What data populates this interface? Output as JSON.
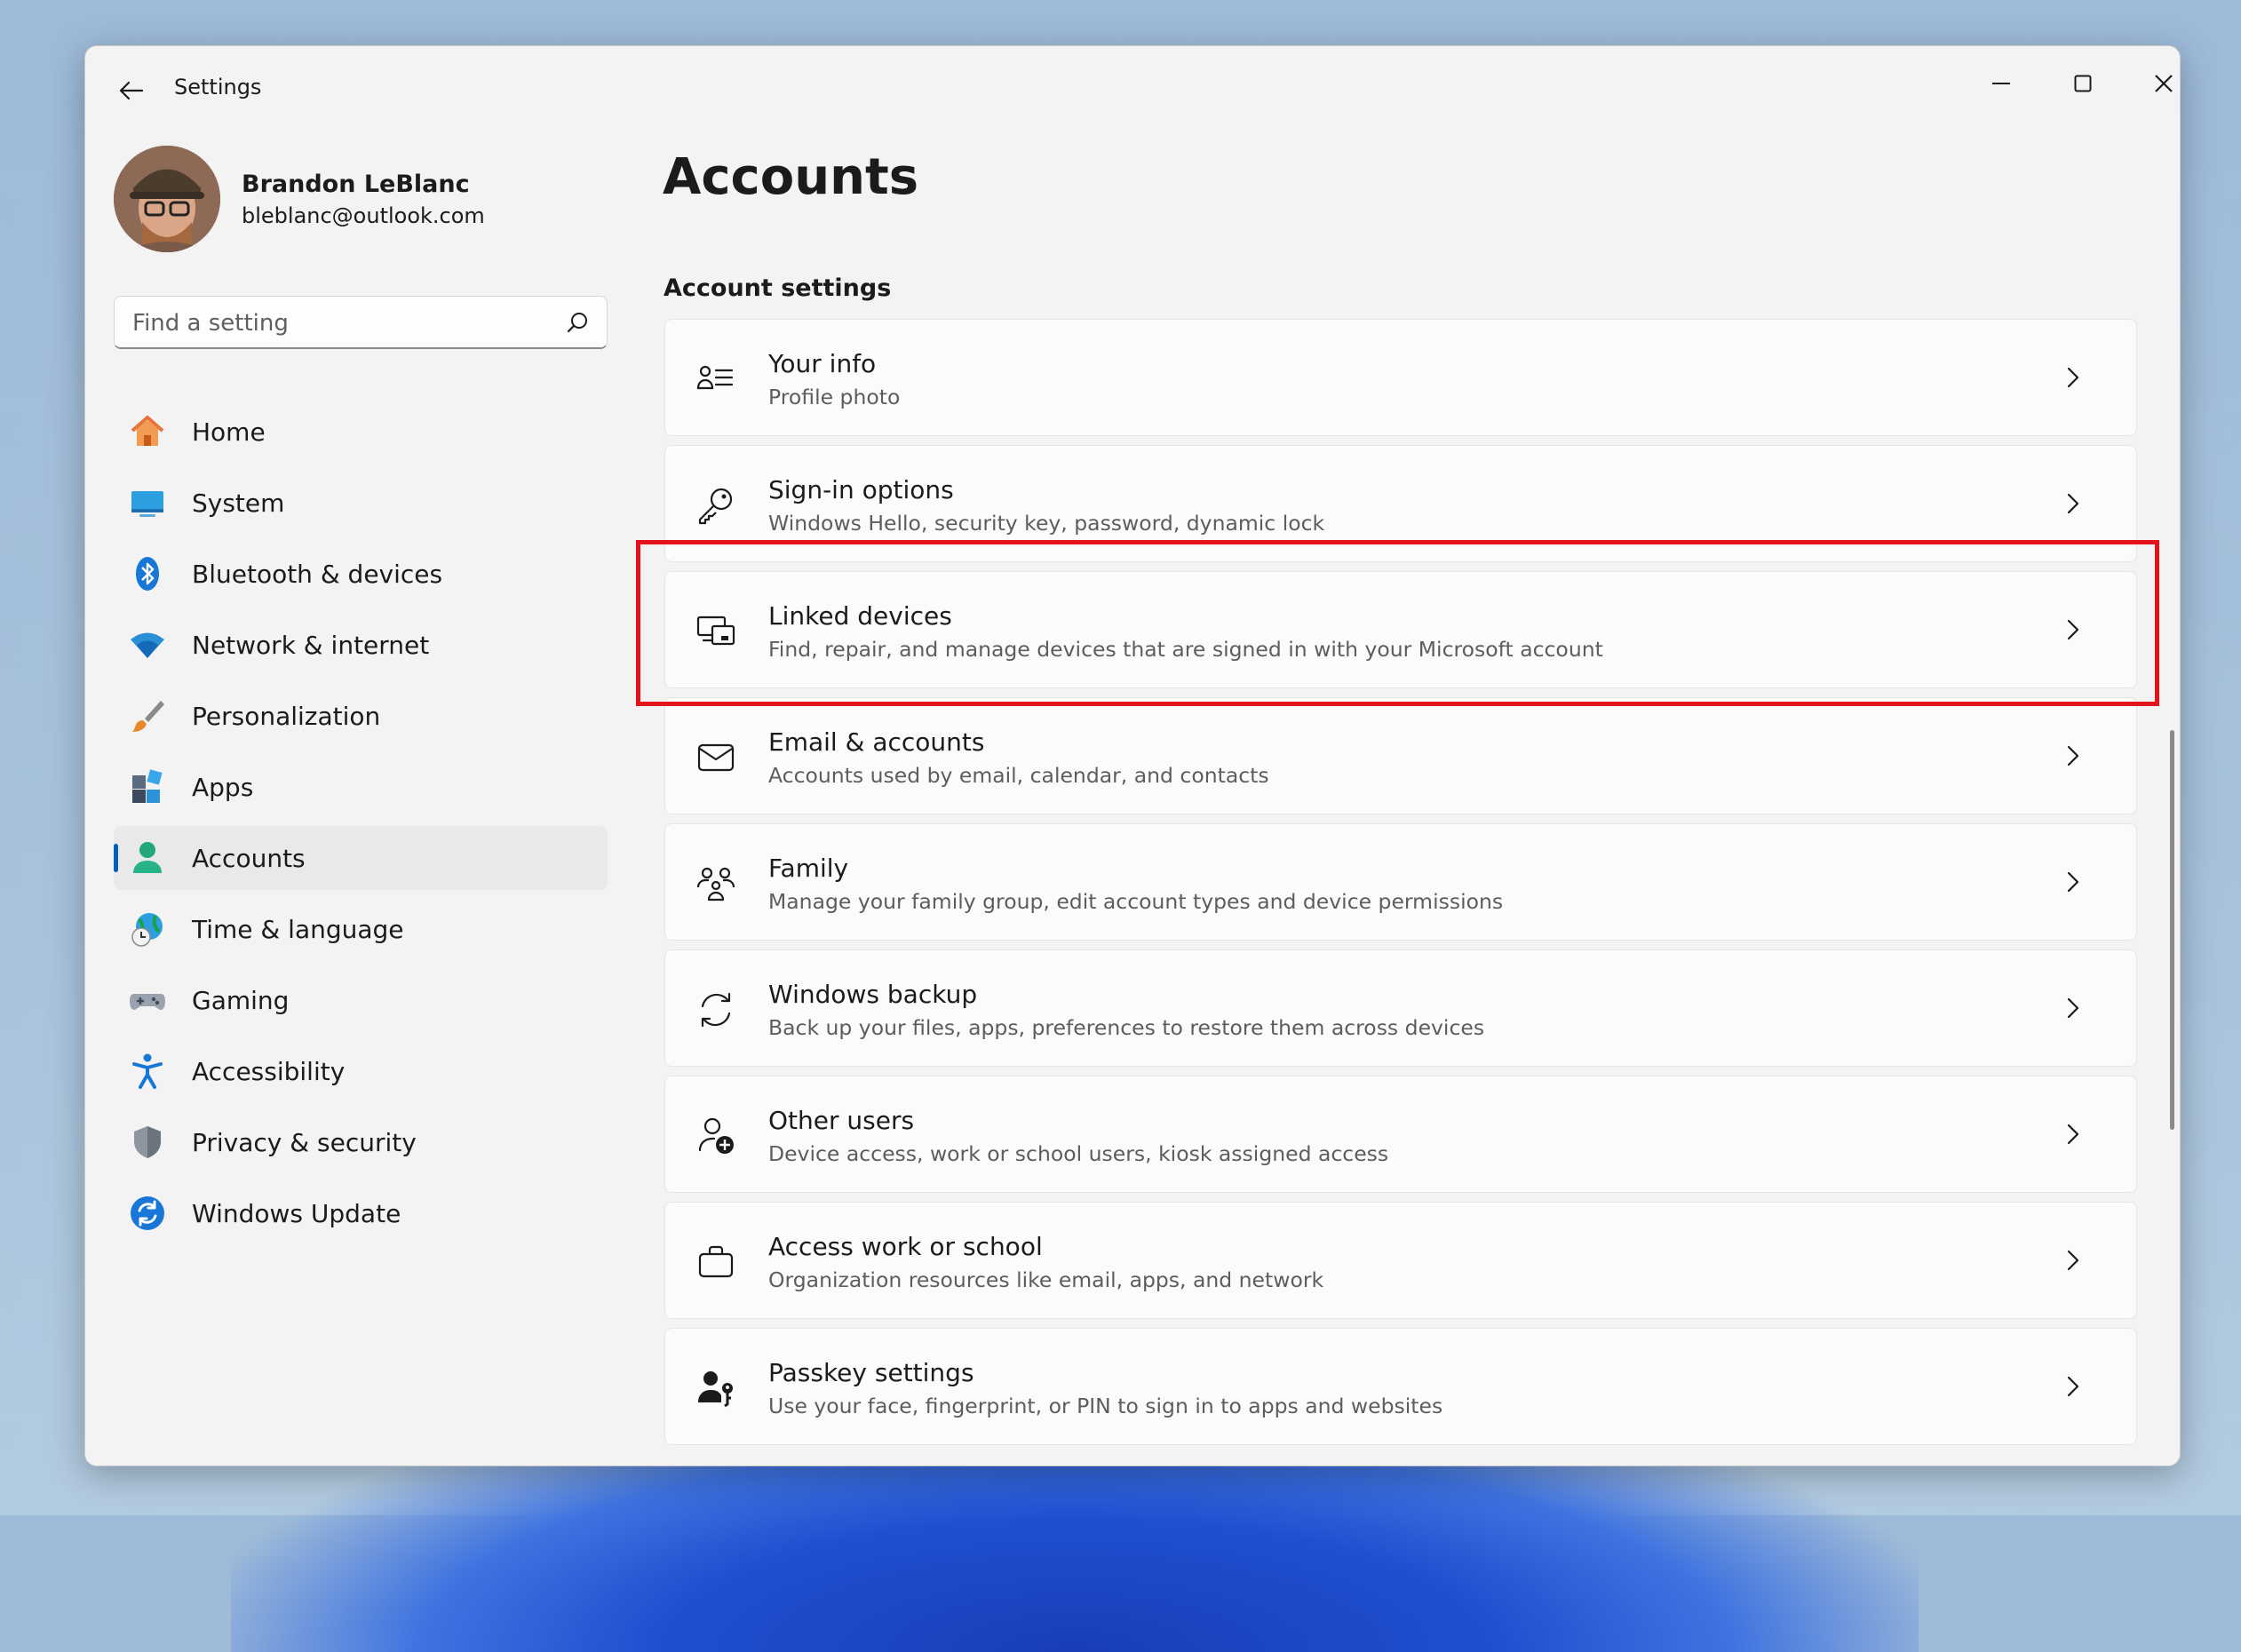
{
  "window": {
    "app_title": "Settings"
  },
  "profile": {
    "name": "Brandon LeBlanc",
    "email": "bleblanc@outlook.com"
  },
  "search": {
    "placeholder": "Find a setting"
  },
  "nav": {
    "items": [
      {
        "label": "Home",
        "icon": "home-icon"
      },
      {
        "label": "System",
        "icon": "system-icon"
      },
      {
        "label": "Bluetooth & devices",
        "icon": "bluetooth-icon"
      },
      {
        "label": "Network & internet",
        "icon": "wifi-icon"
      },
      {
        "label": "Personalization",
        "icon": "brush-icon"
      },
      {
        "label": "Apps",
        "icon": "apps-icon"
      },
      {
        "label": "Accounts",
        "icon": "accounts-icon",
        "selected": true
      },
      {
        "label": "Time & language",
        "icon": "clock-globe-icon"
      },
      {
        "label": "Gaming",
        "icon": "gamepad-icon"
      },
      {
        "label": "Accessibility",
        "icon": "accessibility-icon"
      },
      {
        "label": "Privacy & security",
        "icon": "shield-icon"
      },
      {
        "label": "Windows Update",
        "icon": "update-icon"
      }
    ]
  },
  "main": {
    "title": "Accounts",
    "section_title": "Account settings",
    "cards": [
      {
        "title": "Your info",
        "subtitle": "Profile photo",
        "icon": "person-list-icon"
      },
      {
        "title": "Sign-in options",
        "subtitle": "Windows Hello, security key, password, dynamic lock",
        "icon": "key-icon"
      },
      {
        "title": "Linked devices",
        "subtitle": "Find, repair, and manage devices that are signed in with your Microsoft account",
        "icon": "linked-devices-icon",
        "highlighted": true
      },
      {
        "title": "Email & accounts",
        "subtitle": "Accounts used by email, calendar, and contacts",
        "icon": "mail-icon"
      },
      {
        "title": "Family",
        "subtitle": "Manage your family group, edit account types and device permissions",
        "icon": "family-icon"
      },
      {
        "title": "Windows backup",
        "subtitle": "Back up your files, apps, preferences to restore them across devices",
        "icon": "sync-icon"
      },
      {
        "title": "Other users",
        "subtitle": "Device access, work or school users, kiosk assigned access",
        "icon": "add-user-icon"
      },
      {
        "title": "Access work or school",
        "subtitle": "Organization resources like email, apps, and network",
        "icon": "briefcase-icon"
      },
      {
        "title": "Passkey settings",
        "subtitle": "Use your face, fingerprint, or PIN to sign in to apps and websites",
        "icon": "passkey-icon"
      }
    ]
  },
  "colors": {
    "accent": "#005fb8",
    "highlight": "#e3121b",
    "window_bg": "#f3f3f3",
    "card_bg": "#fbfbfb"
  }
}
